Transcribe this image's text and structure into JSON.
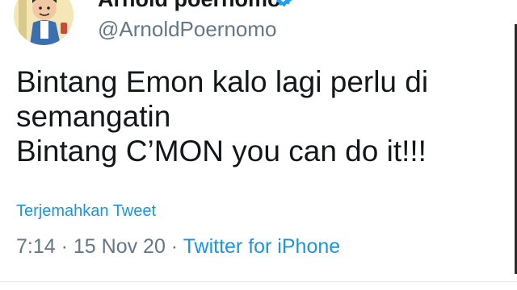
{
  "author": {
    "display_name": "Arnold poernomo",
    "handle": "@ArnoldPoernomo",
    "avatar_icon": "profile-avatar-icon",
    "verified_icon": "verified-badge-icon"
  },
  "tweet": {
    "lines": [
      "Bintang Emon kalo lagi perlu di",
      "semangatin",
      "Bintang C’MON you can do it!!!"
    ],
    "translate_label": "Terjemahkan Tweet"
  },
  "meta": {
    "time": "7:14",
    "separator": " · ",
    "date": "15 Nov 20",
    "source": "Twitter for iPhone"
  },
  "colors": {
    "link": "#1b95e0",
    "secondary_text": "#657786",
    "primary_text": "#14171a"
  }
}
